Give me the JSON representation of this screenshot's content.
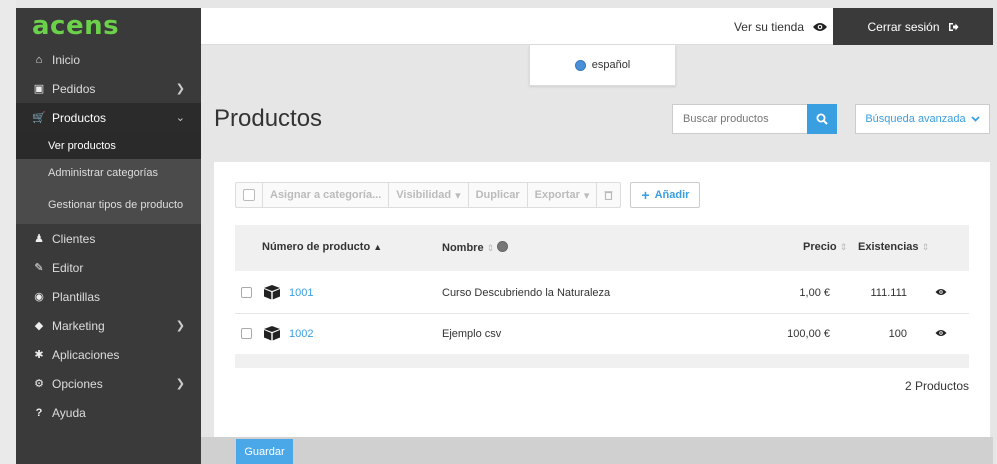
{
  "brand": {
    "logo": "acens",
    "accent": "#3a9fe0",
    "logo_color": "#6cd14a"
  },
  "header": {
    "store_link": "Ver su tienda",
    "logout": "Cerrar sesión"
  },
  "language": {
    "current": "español"
  },
  "sidebar": {
    "items": [
      {
        "label": "Inicio",
        "icon": "home-icon"
      },
      {
        "label": "Pedidos",
        "icon": "orders-icon",
        "has_submenu": true
      },
      {
        "label": "Productos",
        "icon": "cart-icon",
        "has_submenu": true,
        "expanded": true
      },
      {
        "label": "Clientes",
        "icon": "user-icon"
      },
      {
        "label": "Editor",
        "icon": "pencil-icon"
      },
      {
        "label": "Plantillas",
        "icon": "palette-icon"
      },
      {
        "label": "Marketing",
        "icon": "tag-icon",
        "has_submenu": true
      },
      {
        "label": "Aplicaciones",
        "icon": "puzzle-icon"
      },
      {
        "label": "Opciones",
        "icon": "gear-icon",
        "has_submenu": true
      },
      {
        "label": "Ayuda",
        "icon": "question-icon"
      }
    ],
    "submenu": [
      {
        "label": "Ver productos",
        "current": true
      },
      {
        "label": "Administrar categorías"
      },
      {
        "label": "Gestionar tipos de producto"
      }
    ]
  },
  "main": {
    "title": "Productos",
    "search_placeholder": "Buscar productos",
    "advanced_search": "Búsqueda avanzada",
    "toolbar": {
      "assign": "Asignar a categoría...",
      "visibility": "Visibilidad",
      "duplicate": "Duplicar",
      "export": "Exportar",
      "add": "Añadir"
    },
    "columns": {
      "number": "Número de producto",
      "name": "Nombre",
      "price": "Precio",
      "stock": "Existencias"
    },
    "rows": [
      {
        "number": "1001",
        "name": "Curso Descubriendo la Naturaleza",
        "price": "1,00 €",
        "stock": "111.111"
      },
      {
        "number": "1002",
        "name": "Ejemplo csv",
        "price": "100,00 €",
        "stock": "100"
      }
    ],
    "count": "2 Productos",
    "save": "Guardar"
  }
}
